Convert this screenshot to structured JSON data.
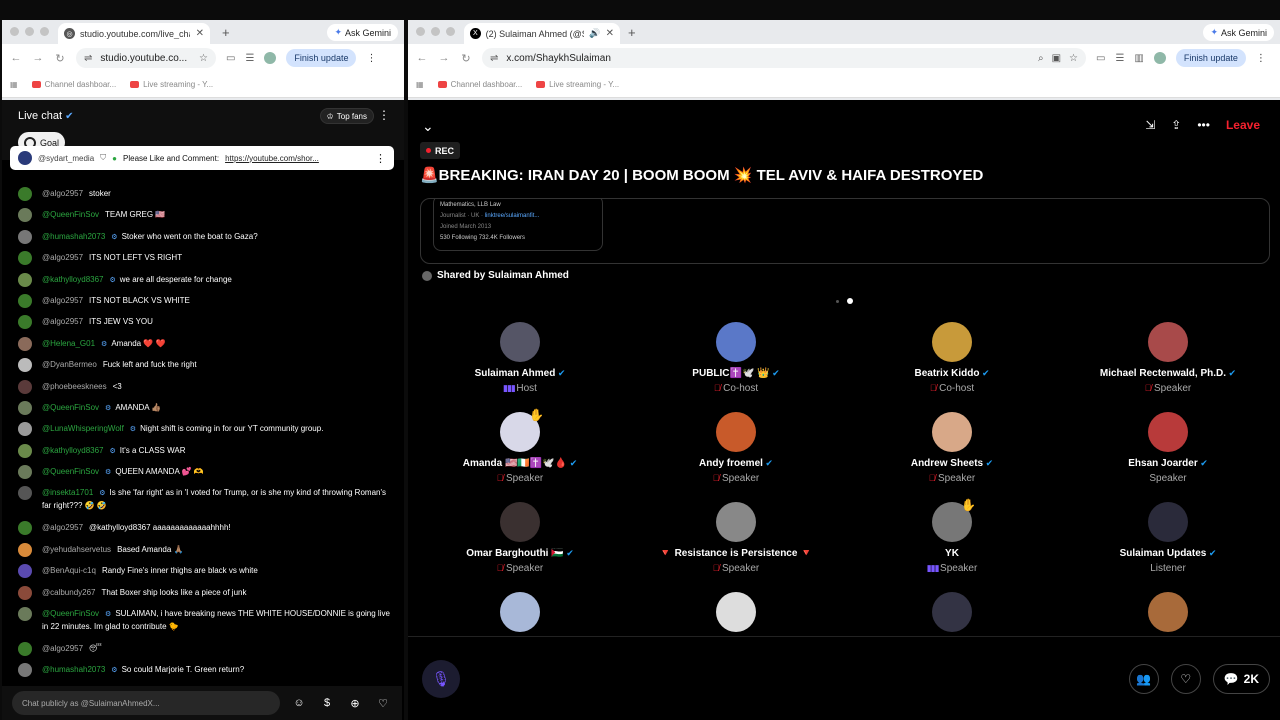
{
  "left_window": {
    "tab_title": "studio.youtube.com/live_chat",
    "gemini_label": "Ask Gemini",
    "url": "studio.youtube.co...",
    "finish_update": "Finish update",
    "bookmarks": [
      "Channel dashboar...",
      "Live streaming - Y..."
    ],
    "chat_title": "Live chat",
    "goal_label": "Goal",
    "top_fans_label": "Top fans",
    "pinned": {
      "author": "@sydart_media",
      "text": "Please Like and Comment:",
      "link": "https://youtube.com/shor..."
    },
    "messages": [
      {
        "author": "@algo2957",
        "text": "stoker",
        "green": false,
        "mod": false,
        "av": "#3a7a2a"
      },
      {
        "author": "@QueenFinSov",
        "text": "TEAM GREG 🇺🇸",
        "green": true,
        "mod": false,
        "av": "#6a7a5a"
      },
      {
        "author": "@humashah2073",
        "text": "Stoker who went on the boat to Gaza?",
        "green": true,
        "mod": true,
        "av": "#777"
      },
      {
        "author": "@algo2957",
        "text": "ITS NOT LEFT VS RIGHT",
        "green": false,
        "mod": false,
        "av": "#3a7a2a"
      },
      {
        "author": "@kathylloyd8367",
        "text": "we are all desperate for change",
        "green": true,
        "mod": true,
        "av": "#6a8a4a"
      },
      {
        "author": "@algo2957",
        "text": "ITS NOT BLACK VS WHITE",
        "green": false,
        "mod": false,
        "av": "#3a7a2a"
      },
      {
        "author": "@algo2957",
        "text": "ITS JEW VS YOU",
        "green": false,
        "mod": false,
        "av": "#3a7a2a"
      },
      {
        "author": "@Helena_G01",
        "text": "Amanda ❤️ ❤️",
        "green": true,
        "mod": true,
        "av": "#8a6a5a"
      },
      {
        "author": "@DyanBermeo",
        "text": "Fuck left and fuck the right",
        "green": false,
        "mod": false,
        "av": "#bbb"
      },
      {
        "author": "@phoebeesknees",
        "text": "<3",
        "green": false,
        "mod": false,
        "av": "#5a3a3a"
      },
      {
        "author": "@QueenFinSov",
        "text": "AMANDA 👍🏽",
        "green": true,
        "mod": true,
        "av": "#6a7a5a"
      },
      {
        "author": "@LunaWhisperingWolf",
        "text": "Night shift is coming in for our YT community group.",
        "green": true,
        "mod": true,
        "av": "#9a9a9a"
      },
      {
        "author": "@kathylloyd8367",
        "text": "It's a CLASS WAR",
        "green": true,
        "mod": true,
        "av": "#6a8a4a"
      },
      {
        "author": "@QueenFinSov",
        "text": "QUEEN AMANDA 💕 🫶",
        "green": true,
        "mod": true,
        "av": "#6a7a5a"
      },
      {
        "author": "@insekta1701",
        "text": "Is she 'far right' as in 'I voted for Trump, or is she my kind of throwing Roman's far right??? 🤣 🤣",
        "green": true,
        "mod": true,
        "av": "#555",
        "tall": true
      },
      {
        "author": "@algo2957",
        "text": "@kathylloyd8367 aaaaaaaaaaaaahhhh!",
        "green": false,
        "mod": false,
        "av": "#3a7a2a"
      },
      {
        "author": "@yehudahservetus",
        "text": "Based Amanda 🙏🏽",
        "green": false,
        "mod": false,
        "av": "#d88a3a"
      },
      {
        "author": "@BenAqui-c1q",
        "text": "Randy Fine's inner thighs are black vs white",
        "green": false,
        "mod": false,
        "av": "#5a4ab0"
      },
      {
        "author": "@calbundy267",
        "text": "That Boxer ship looks like a piece of junk",
        "green": false,
        "mod": false,
        "av": "#8a4a3a"
      },
      {
        "author": "@QueenFinSov",
        "text": "SULAIMAN, i have breaking news THE WHITE HOUSE/DONNIE is going live in 22 minutes. Im glad to contribute 🐤",
        "green": true,
        "mod": true,
        "av": "#6a7a5a",
        "tall": true
      },
      {
        "author": "@algo2957",
        "text": "😴",
        "green": false,
        "mod": false,
        "av": "#3a7a2a"
      },
      {
        "author": "@humashah2073",
        "text": "So could Marjorie T. Green return?",
        "green": true,
        "mod": true,
        "av": "#777"
      }
    ],
    "chat_placeholder": "Chat publicly as @SulaimanAhmedX..."
  },
  "right_window": {
    "tab_title": "(2) Sulaiman Ahmed (@S",
    "gemini_label": "Ask Gemini",
    "url": "x.com/ShaykhSulaiman",
    "finish_update": "Finish update",
    "bookmarks": [
      "Channel dashboar...",
      "Live streaming - Y..."
    ],
    "leave_label": "Leave",
    "rec_label": "REC",
    "title": "🚨BREAKING: IRAN DAY 20 | BOOM BOOM 💥 TEL AVIV & HAIFA DESTROYED",
    "embed": {
      "line1": "Mathematics, LLB Law",
      "line2a": "Journalist · UK · ",
      "line2b": "linktree/sulaimanfit...",
      "line3": "Joined March 2013",
      "line4": "530 Following  732.4K Followers"
    },
    "shared_by": "Shared by Sulaiman Ahmed",
    "participants": [
      {
        "name": "Sulaiman Ahmed",
        "verified": true,
        "role": "Host",
        "icon": "bars",
        "av": "#556"
      },
      {
        "name": "PUBLIC✝️🕊️ 👑",
        "verified": true,
        "role": "Co-host",
        "icon": "red",
        "av": "#5a78c8"
      },
      {
        "name": "Beatrix Kiddo",
        "verified": true,
        "role": "Co-host",
        "icon": "red",
        "av": "#c89a3a"
      },
      {
        "name": "Michael Rectenwald, Ph.D.",
        "verified": true,
        "role": "Speaker",
        "icon": "red",
        "av": "#a84a4a"
      },
      {
        "name": "Amanda 🇺🇸🇮🇪✝️🕊️🩸",
        "verified": true,
        "role": "Speaker",
        "icon": "red",
        "av": "#d8d8e8",
        "hand": true
      },
      {
        "name": "Andy froemel",
        "verified": true,
        "role": "Speaker",
        "icon": "red",
        "av": "#c85a2a"
      },
      {
        "name": "Andrew Sheets",
        "verified": true,
        "role": "Speaker",
        "icon": "red",
        "av": "#d8a888"
      },
      {
        "name": "Ehsan Joarder",
        "verified": true,
        "role": "Speaker",
        "icon": "none",
        "av": "#b83a3a"
      },
      {
        "name": "Omar Barghouthi 🇵🇸",
        "verified": true,
        "role": "Speaker",
        "icon": "red",
        "av": "#3a3030"
      },
      {
        "name": "🔻 Resistance is Persistence 🔻",
        "verified": false,
        "role": "Speaker",
        "icon": "red",
        "av": "#888"
      },
      {
        "name": "YK",
        "verified": false,
        "role": "Speaker",
        "icon": "bars",
        "av": "#777",
        "hand": true
      },
      {
        "name": "Sulaiman Updates",
        "verified": true,
        "role": "Listener",
        "icon": "none",
        "av": "#2a2a3a"
      },
      {
        "name": "",
        "verified": false,
        "role": "",
        "icon": "none",
        "av": "#a8b8d8"
      },
      {
        "name": "",
        "verified": false,
        "role": "",
        "icon": "none",
        "av": "#ddd"
      },
      {
        "name": "",
        "verified": false,
        "role": "",
        "icon": "none",
        "av": "#334"
      },
      {
        "name": "",
        "verified": false,
        "role": "",
        "icon": "none",
        "av": "#a86a3a"
      }
    ],
    "comment_count": "2K"
  }
}
